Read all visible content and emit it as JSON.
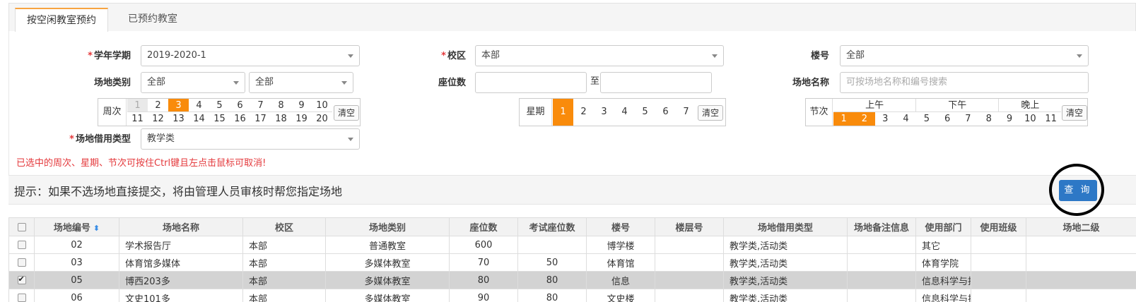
{
  "tabs": [
    {
      "label": "按空闲教室预约"
    },
    {
      "label": "已预约教室"
    }
  ],
  "form": {
    "term": {
      "label": "学年学期",
      "value": "2019-2020-1"
    },
    "campus": {
      "label": "校区",
      "value": "本部"
    },
    "building": {
      "label": "楼号",
      "value": "全部"
    },
    "venue_type": {
      "label": "场地类别",
      "value1": "全部",
      "value2": "全部"
    },
    "seats": {
      "label": "座位数",
      "to": "至"
    },
    "venue_name": {
      "label": "场地名称",
      "placeholder": "可按场地名称和编号搜索"
    },
    "borrow_type": {
      "label": "场地借用类型",
      "value": "教学类"
    },
    "weeks": {
      "label": "周次",
      "row1": [
        "1",
        "2",
        "3",
        "4",
        "5",
        "6",
        "7",
        "8",
        "9",
        "10"
      ],
      "row2": [
        "11",
        "12",
        "13",
        "14",
        "15",
        "16",
        "17",
        "18",
        "19",
        "20"
      ],
      "selected": [
        "3"
      ],
      "disabled": [
        "1"
      ],
      "clear": "清空"
    },
    "weekday": {
      "label": "星期",
      "days": [
        "1",
        "2",
        "3",
        "4",
        "5",
        "6",
        "7"
      ],
      "selected": [
        "1"
      ],
      "clear": "清空"
    },
    "periods": {
      "label": "节次",
      "groups": [
        "上午",
        "下午",
        "晚上"
      ],
      "items": [
        "1",
        "2",
        "3",
        "4",
        "5",
        "6",
        "7",
        "8",
        "9",
        "10",
        "11"
      ],
      "selected": [
        "1",
        "2"
      ],
      "clear": "清空"
    },
    "required_mark": "*"
  },
  "warning": "已选中的周次、星期、节次可按住Ctrl键且左点击鼠标可取消!",
  "hint": "提示：如果不选场地直接提交，将由管理人员审核时帮您指定场地",
  "query_button": "查 询",
  "table": {
    "headers": [
      "场地编号",
      "场地名称",
      "校区",
      "场地类别",
      "座位数",
      "考试座位数",
      "楼号",
      "楼层号",
      "场地借用类型",
      "场地备注信息",
      "使用部门",
      "使用班级",
      "场地二级"
    ],
    "rows": [
      {
        "checked": false,
        "cells": [
          "02",
          "学术报告厅",
          "本部",
          "普通教室",
          "600",
          "",
          "博学楼",
          "",
          "教学类,活动类",
          "",
          "其它",
          "",
          ""
        ]
      },
      {
        "checked": false,
        "cells": [
          "03",
          "体育馆多媒体",
          "本部",
          "多媒体教室",
          "70",
          "50",
          "体育馆",
          "",
          "教学类,活动类",
          "",
          "体育学院",
          "",
          ""
        ]
      },
      {
        "checked": true,
        "cells": [
          "05",
          "博西203多",
          "本部",
          "多媒体教室",
          "80",
          "80",
          "信息",
          "",
          "教学类,活动类",
          "",
          "信息科学与技",
          "",
          ""
        ]
      },
      {
        "checked": false,
        "cells": [
          "06",
          "文史101多",
          "本部",
          "多媒体教室",
          "90",
          "80",
          "文史楼",
          "",
          "教学类,活动类",
          "",
          "信息科学与技",
          "",
          ""
        ]
      }
    ]
  },
  "colors": {
    "accent": "#f98b0b",
    "primary": "#2d78c6",
    "warning": "#e4393c"
  }
}
